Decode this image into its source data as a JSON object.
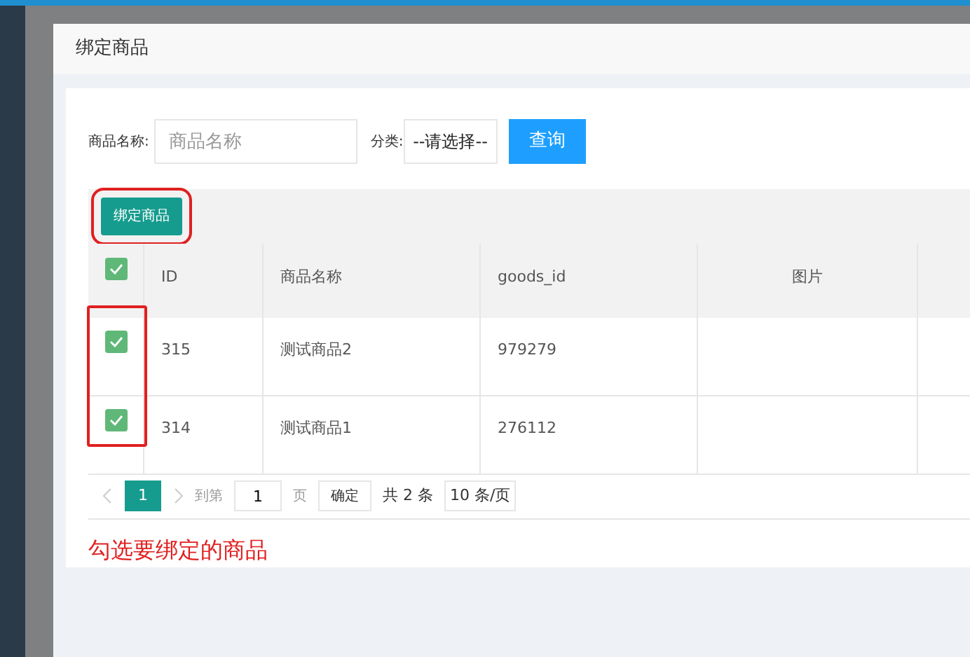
{
  "dialog": {
    "title": "绑定商品"
  },
  "filters": {
    "name_label": "商品名称:",
    "name_placeholder": "商品名称",
    "category_label": "分类:",
    "category_value": "--请选择--",
    "query_button": "查询"
  },
  "toolbar": {
    "bind_button": "绑定商品"
  },
  "table": {
    "select_all_checked": true,
    "columns": [
      "ID",
      "商品名称",
      "goods_id",
      "图片"
    ],
    "rows": [
      {
        "cells": [
          "315",
          "测试商品2",
          "979279",
          ""
        ],
        "checked": true
      },
      {
        "cells": [
          "314",
          "测试商品1",
          "276112",
          ""
        ],
        "checked": true
      }
    ]
  },
  "pagination": {
    "pages": [
      {
        "label": "1",
        "selected": true
      }
    ],
    "goto_label": "到第",
    "goto_value": "1",
    "page_unit": "页",
    "confirm": "确定",
    "total": "共 2 条",
    "page_size": "10 条/页"
  },
  "annotation": "勾选要绑定的商品"
}
